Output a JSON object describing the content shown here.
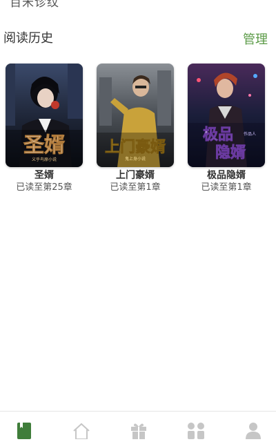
{
  "top": {
    "cut_text": "百米诊纹"
  },
  "history": {
    "title": "阅读历史",
    "manage_label": "管理"
  },
  "books": [
    {
      "title": "圣婿",
      "progress": "已读至第25章",
      "cover_text": "圣婿",
      "cover_subtitle": "义乎鸟原小说"
    },
    {
      "title": "上门豪婿",
      "progress": "已读至第1章",
      "cover_text": "上门豪婿",
      "cover_subtitle": "鬼上身小说"
    },
    {
      "title": "极品隐婿",
      "progress": "已读至第1章",
      "cover_text_1": "极品",
      "cover_text_2": "隐婿",
      "cover_subtitle": "作品人"
    }
  ],
  "tabbar": {
    "active_color": "#3f7d3a",
    "inactive_color": "#c6c6c6",
    "tabs": [
      {
        "icon": "bookshelf-icon",
        "active": true
      },
      {
        "icon": "home-icon",
        "active": false
      },
      {
        "icon": "gift-icon",
        "active": false
      },
      {
        "icon": "category-icon",
        "active": false
      },
      {
        "icon": "profile-icon",
        "active": false
      }
    ]
  },
  "colors": {
    "accent": "#5a9a46"
  }
}
